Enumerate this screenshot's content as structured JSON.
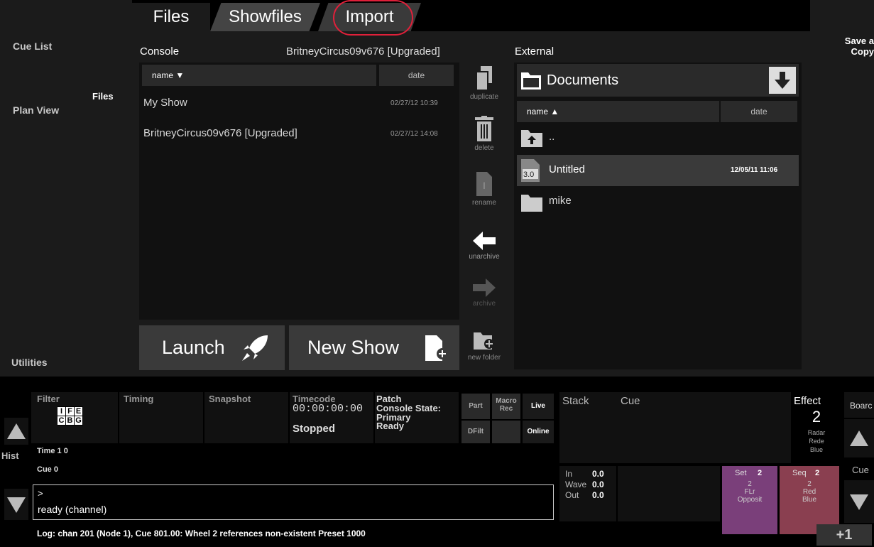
{
  "left_nav": {
    "items": [
      "Cue List",
      "Plan View",
      "Utilities"
    ]
  },
  "sub_nav": {
    "label": "Files"
  },
  "right_nav": {
    "save_copy": "Save a Copy"
  },
  "tabs": [
    "Files",
    "Showfiles",
    "Import"
  ],
  "console": {
    "title": "Console",
    "current_show": "BritneyCircus09v676 [Upgraded]",
    "col_name": "name ▼",
    "col_date": "date",
    "rows": [
      {
        "name": "My Show",
        "date": "02/27/12 10:39"
      },
      {
        "name": "BritneyCircus09v676 [Upgraded]",
        "date": "02/27/12 14:08"
      }
    ]
  },
  "tools": {
    "duplicate": "duplicate",
    "delete": "delete",
    "rename": "rename",
    "unarchive": "unarchive",
    "archive": "archive",
    "new_folder": "new folder"
  },
  "external": {
    "title": "External",
    "folder": "Documents",
    "col_name": "name ▲",
    "col_date": "date",
    "rows": [
      {
        "name": "..",
        "date": "",
        "icon": "folder-up-icon"
      },
      {
        "name": "Untitled",
        "date": "12/05/11 11:06",
        "icon": "show-file-icon",
        "badge": "3.0"
      },
      {
        "name": "mike",
        "date": "",
        "icon": "folder-icon"
      }
    ]
  },
  "buttons": {
    "launch": "Launch",
    "new_show": "New Show"
  },
  "bottom": {
    "filter": "Filter",
    "timing": "Timing",
    "snapshot": "Snapshot",
    "timecode_label": "Timecode",
    "timecode_value": "00:00:00:00",
    "timecode_state": "Stopped",
    "patch_label": "Patch",
    "console_state_label": "Console State:",
    "console_state_1": "Primary",
    "console_state_2": "Ready",
    "part": "Part",
    "macro_rec": "Macro Rec",
    "live": "Live",
    "dfilt": "DFilt",
    "online": "Online",
    "ife": [
      "I",
      "F",
      "E"
    ],
    "cbg": [
      "C",
      "B",
      "G"
    ],
    "time": "Time 1 0",
    "cue": "Cue 0",
    "hist": "Hist",
    "cmd_prompt": ">",
    "cmd_status": "ready (channel)",
    "stack": "Stack",
    "cue_header": "Cue",
    "effect": "Effect",
    "effect_num": "2",
    "effect_lines": [
      "Radar",
      "Rede",
      "Blue"
    ],
    "board": "Boarc",
    "cue_side": "Cue",
    "in": "In",
    "in_val": "0.0",
    "wave": "Wave",
    "wave_val": "0.0",
    "out": "Out",
    "out_val": "0.0",
    "set_label": "Set",
    "set_num": "2",
    "set_lines": [
      "2",
      "FLr",
      "Opposit"
    ],
    "seq_label": "Seq",
    "seq_num": "2",
    "seq_lines": [
      "2",
      "Red",
      "Blue"
    ],
    "log": "Log: chan 201 (Node 1), Cue 801.00: Wheel 2 references non-existent Preset 1000",
    "plus_one": "+1"
  },
  "colors": {
    "accent_ring": "#e0203a",
    "set_tile": "#7a3f7a",
    "seq_tile": "#8a3f50"
  }
}
